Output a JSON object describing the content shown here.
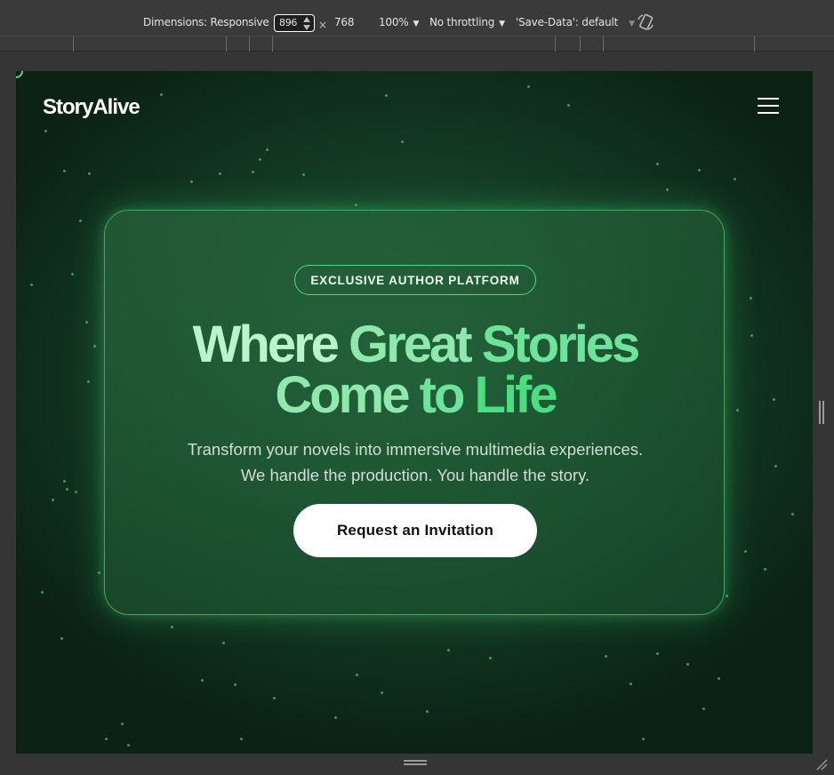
{
  "devtools": {
    "dimensions_label": "Dimensions: Responsive",
    "width_value": "896",
    "times": "×",
    "height_value": "768",
    "zoom": "100%",
    "throttling": "No throttling",
    "save_data": "'Save-Data': default"
  },
  "site": {
    "brand": "StoryAlive",
    "badge": "EXCLUSIVE AUTHOR PLATFORM",
    "headline": {
      "word1": "Where",
      "word2": "Great",
      "word3": "Stories",
      "word4": "Come",
      "word5": "to",
      "word6": "Life"
    },
    "subtext_line1": "Transform your novels into immersive multimedia experiences.",
    "subtext_line2": "We handle the production. You handle the story.",
    "cta_label": "Request an Invitation"
  },
  "colors": {
    "accent_green": "#4ade80",
    "background_dark": "#0b2214",
    "cta_background": "#ffffff"
  },
  "icons": {
    "menu": "hamburger-menu-icon",
    "rotate": "rotate-device-icon"
  }
}
